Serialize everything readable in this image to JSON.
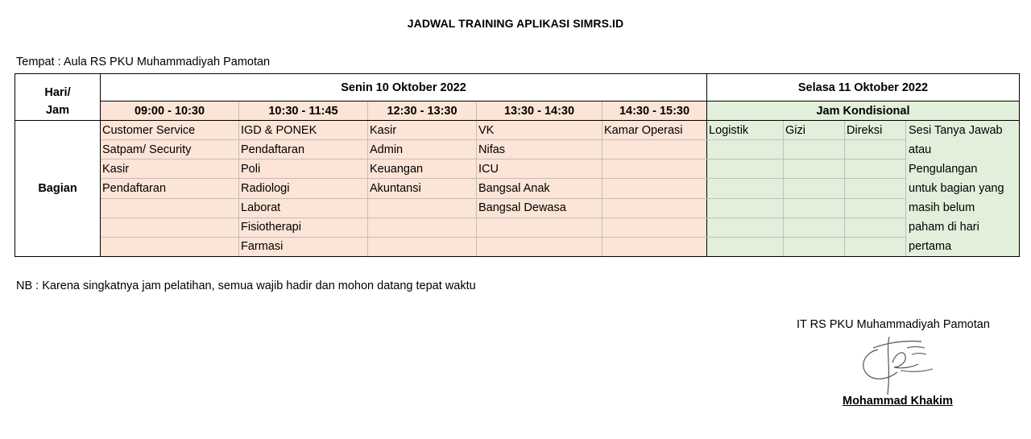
{
  "title": "JADWAL TRAINING APLIKASI SIMRS.ID",
  "venue": "Tempat : Aula RS PKU Muhammadiyah Pamotan",
  "table": {
    "hari_label_1": "Hari/",
    "hari_label_2": "Jam",
    "day1": "Senin 10 Oktober 2022",
    "day2": "Selasa 11 Oktober 2022",
    "times": [
      "09:00 - 10:30",
      "10:30 - 11:45",
      "12:30 - 13:30",
      "13:30 - 14:30",
      "14:30 - 15:30"
    ],
    "jam_kondisional": "Jam Kondisional",
    "row_label": "Bagian",
    "rows": [
      [
        "Customer Service",
        "IGD & PONEK",
        "Kasir",
        "VK",
        "Kamar Operasi",
        "Logistik",
        "Gizi",
        "Direksi"
      ],
      [
        "Satpam/ Security",
        "Pendaftaran",
        "Admin",
        "Nifas",
        "",
        "",
        "",
        ""
      ],
      [
        "Kasir",
        "Poli",
        "Keuangan",
        "ICU",
        "",
        "",
        "",
        ""
      ],
      [
        "Pendaftaran",
        "Radiologi",
        "Akuntansi",
        "Bangsal Anak",
        "",
        "",
        "",
        ""
      ],
      [
        "",
        "Laborat",
        "",
        "Bangsal Dewasa",
        "",
        "",
        "",
        ""
      ],
      [
        "",
        "Fisiotherapi",
        "",
        "",
        "",
        "",
        "",
        ""
      ],
      [
        "",
        "Farmasi",
        "",
        "",
        "",
        "",
        "",
        ""
      ]
    ],
    "qa_lines": [
      "Sesi Tanya Jawab",
      "atau",
      "Pengulangan",
      "untuk bagian yang",
      "masih belum",
      "paham di hari",
      "pertama"
    ]
  },
  "note": "NB : Karena singkatnya jam pelatihan, semua wajib hadir dan mohon datang tepat waktu",
  "signature": {
    "org": "IT RS PKU Muhammadiyah Pamotan",
    "name": "Mohammad Khakim"
  }
}
